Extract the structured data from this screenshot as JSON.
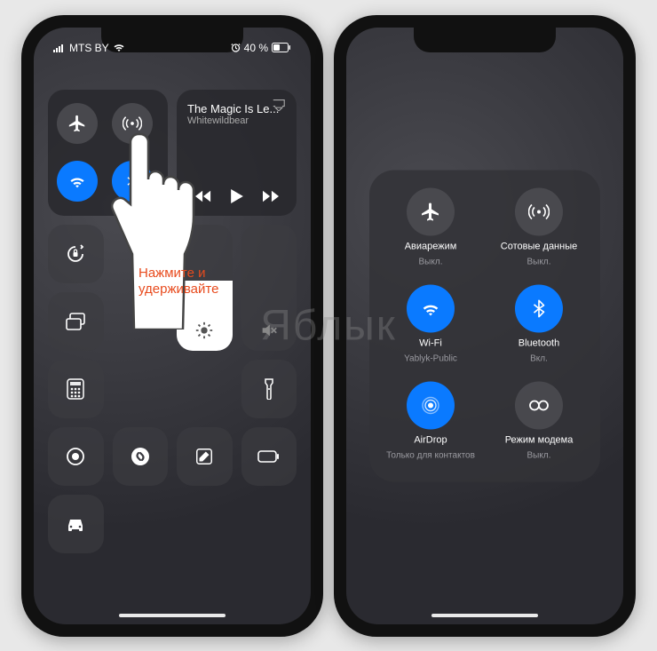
{
  "watermark": "Яблык",
  "statusbar": {
    "carrier": "MTS BY",
    "battery_text": "40 %"
  },
  "left": {
    "music": {
      "title": "The Magic Is Le...",
      "artist": "Whitewildbear"
    },
    "instruction_line1": "Нажмите и",
    "instruction_line2": "удерживайте"
  },
  "expanded": {
    "airplane": {
      "label": "Авиарежим",
      "status": "Выкл."
    },
    "cellular": {
      "label": "Сотовые данные",
      "status": "Выкл."
    },
    "wifi": {
      "label": "Wi-Fi",
      "status": "Yablyk-Public"
    },
    "bluetooth": {
      "label": "Bluetooth",
      "status": "Вкл."
    },
    "airdrop": {
      "label": "AirDrop",
      "status": "Только для контактов"
    },
    "hotspot": {
      "label": "Режим модема",
      "status": "Выкл."
    }
  }
}
